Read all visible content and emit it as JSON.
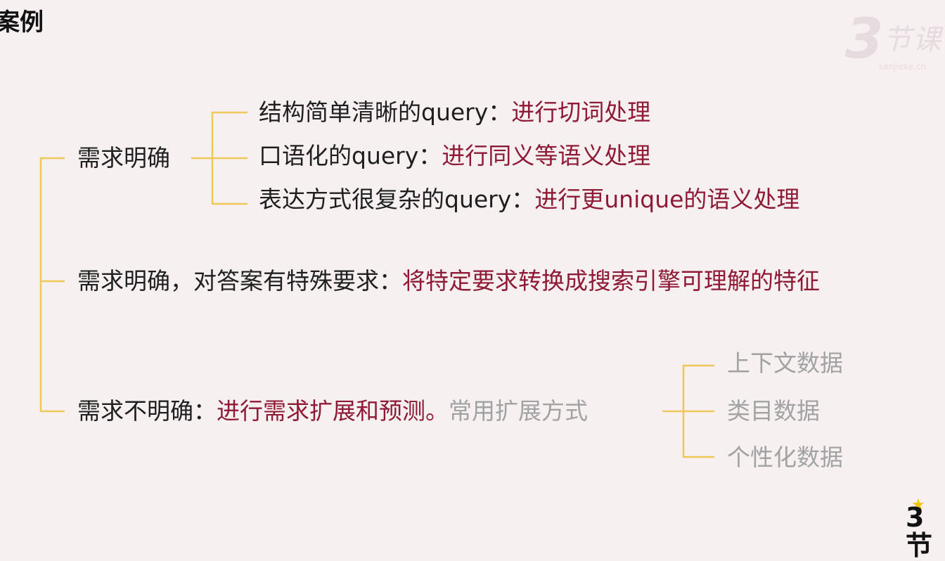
{
  "title": "案例",
  "watermark": {
    "big": "3",
    "small": "节课",
    "domain": "sanjieke.cn"
  },
  "corner_logo": {
    "star": "★",
    "text": "3节"
  },
  "colors": {
    "line": "#efc85a",
    "dark": "#1f1f1f",
    "red": "#8e1a35",
    "gray": "#a2a2a2",
    "background": "#f7f0f1"
  },
  "branches": [
    {
      "label": "需求明确",
      "children": [
        {
          "prefix": "结构简单清晰的query：",
          "action": "进行切词处理"
        },
        {
          "prefix": "口语化的query：",
          "action": "进行同义等语义处理"
        },
        {
          "prefix": "表达方式很复杂的query：",
          "action": "进行更unique的语义处理"
        }
      ]
    },
    {
      "label": "需求明确，对答案有特殊要求：",
      "action": "将特定要求转换成搜索引擎可理解的特征"
    },
    {
      "label": "需求不明确：",
      "action": "进行需求扩展和预测。",
      "note": "常用扩展方式",
      "children": [
        "上下文数据",
        "类目数据",
        "个性化数据"
      ]
    }
  ]
}
